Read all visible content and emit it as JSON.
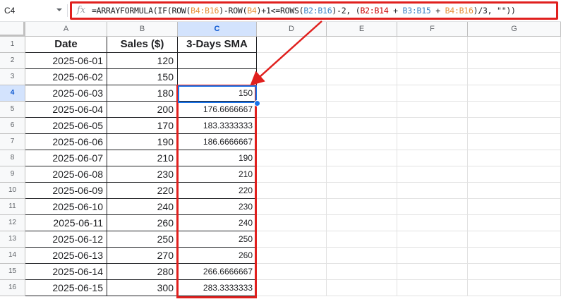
{
  "name_box": "C4",
  "formula_bar": {
    "fx_label": "fx",
    "formula": "=ARRAYFORMULA(IF(ROW(B4:B16)-ROW(B4)+1<=ROWS(B2:B16)-2, (B2:B14 + B3:B15 + B4:B16)/3, \"\"))"
  },
  "columns": [
    "A",
    "B",
    "C",
    "D",
    "E",
    "F",
    "G"
  ],
  "rows": [
    "1",
    "2",
    "3",
    "4",
    "5",
    "6",
    "7",
    "8",
    "9",
    "10",
    "11",
    "12",
    "13",
    "14",
    "15",
    "16"
  ],
  "table": {
    "headers": [
      "Date",
      "Sales ($)",
      "3-Days SMA"
    ],
    "data": [
      [
        "2025-06-01",
        "120",
        ""
      ],
      [
        "2025-06-02",
        "150",
        ""
      ],
      [
        "2025-06-03",
        "180",
        "150"
      ],
      [
        "2025-06-04",
        "200",
        "176.6666667"
      ],
      [
        "2025-06-05",
        "170",
        "183.3333333"
      ],
      [
        "2025-06-06",
        "190",
        "186.6666667"
      ],
      [
        "2025-06-07",
        "210",
        "190"
      ],
      [
        "2025-06-08",
        "230",
        "210"
      ],
      [
        "2025-06-09",
        "220",
        "220"
      ],
      [
        "2025-06-10",
        "240",
        "230"
      ],
      [
        "2025-06-11",
        "260",
        "240"
      ],
      [
        "2025-06-12",
        "250",
        "250"
      ],
      [
        "2025-06-13",
        "270",
        "260"
      ],
      [
        "2025-06-14",
        "280",
        "266.6666667"
      ],
      [
        "2025-06-15",
        "300",
        "283.3333333"
      ]
    ]
  },
  "colors": {
    "annotation_red": "#e0201e",
    "selection_blue": "#1a73e8",
    "ref_b4b16": "#e69138",
    "ref_b2b16": "#3d85c6",
    "ref_b2b14": "#cc0000",
    "ref_b3b15": "#3d85c6"
  },
  "icons": [
    "fx-icon",
    "dropdown-arrow-icon",
    "annotation-arrow"
  ]
}
